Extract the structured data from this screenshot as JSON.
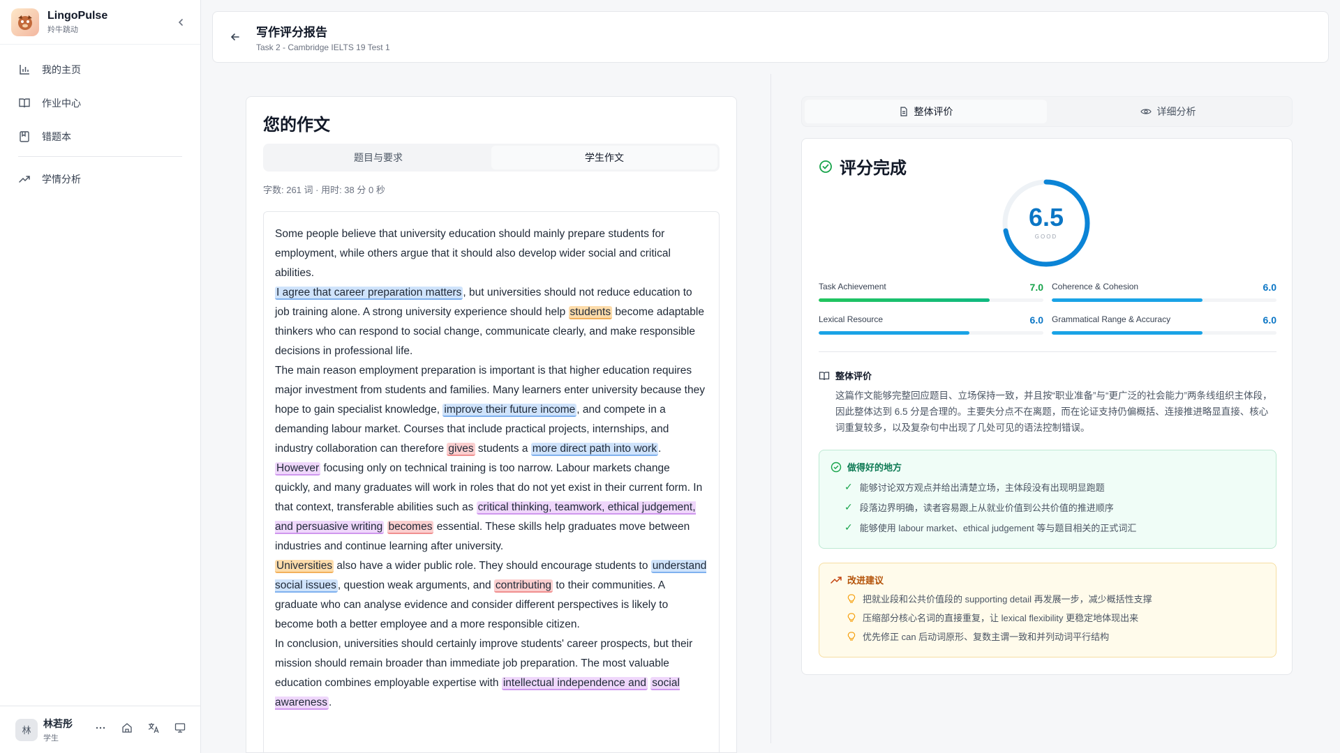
{
  "brand": {
    "name": "LingoPulse",
    "sub": "羚牛跳动"
  },
  "nav": [
    {
      "label": "我的主页",
      "icon": "bar-chart-icon"
    },
    {
      "label": "作业中心",
      "icon": "book-open-icon"
    },
    {
      "label": "错题本",
      "icon": "notebook-icon"
    },
    {
      "label": "学情分析",
      "icon": "trending-up-icon"
    }
  ],
  "user": {
    "avatar": "林",
    "name": "林若彤",
    "role": "学生"
  },
  "header": {
    "title": "写作评分报告",
    "subtitle": "Task 2 - Cambridge IELTS 19 Test 1"
  },
  "essay": {
    "title": "您的作文",
    "tabs": [
      "题目与要求",
      "学生作文"
    ],
    "meta": "字数: 261 词 · 用时: 38 分 0 秒",
    "p1": "Some people believe that university education should mainly prepare students for employment, while others argue that it should also develop wider social and critical abilities.",
    "p2": [
      {
        "hl": "blue",
        "t": "I agree that career preparation matters"
      },
      {
        "t": ", but universities should not reduce education to job training alone. A strong university experience should help "
      },
      {
        "hl": "orange",
        "t": "students"
      },
      {
        "t": " become adaptable thinkers who can respond to social change, communicate clearly, and make responsible decisions in professional life."
      }
    ],
    "p3": [
      {
        "t": "The main reason employment preparation is important is that higher education requires major investment from students and families. Many learners enter university because they hope to gain specialist knowledge, "
      },
      {
        "hl": "blue",
        "t": "improve their future income"
      },
      {
        "t": ", and compete in a demanding labour market. Courses that include practical projects, internships, and industry collaboration can therefore "
      },
      {
        "hl": "red",
        "t": "gives"
      },
      {
        "t": " students a "
      },
      {
        "hl": "blue",
        "t": "more direct path into work"
      },
      {
        "t": "."
      }
    ],
    "p4": [
      {
        "hl": "purple",
        "t": "However"
      },
      {
        "t": " focusing only on technical training is too narrow. Labour markets change quickly, and many graduates will work in roles that do not yet exist in their current form. In that context, transferable abilities such as "
      },
      {
        "hl": "purple",
        "t": "critical thinking, teamwork, ethical judgement, and persuasive writing"
      },
      {
        "t": " "
      },
      {
        "hl": "red",
        "t": "becomes"
      },
      {
        "t": " essential. These skills help graduates move between industries and continue learning after university."
      }
    ],
    "p5": [
      {
        "hl": "orange",
        "t": "Universities"
      },
      {
        "t": " also have a wider public role. They should encourage students to "
      },
      {
        "hl": "blue",
        "t": "understand social issues"
      },
      {
        "t": ", question weak arguments, and "
      },
      {
        "hl": "red",
        "t": "contributing"
      },
      {
        "t": " to their communities. A graduate who can analyse evidence and consider different perspectives is likely to become both a better employee and a more responsible citizen."
      }
    ],
    "p6": [
      {
        "t": "In conclusion, universities should certainly improve students' career prospects, but their mission should remain broader than immediate job preparation. The most valuable education combines employable expertise with "
      },
      {
        "hl": "purple",
        "t": "intellectual independence and"
      },
      {
        "t": " "
      },
      {
        "hl": "purple",
        "t": "social awareness"
      },
      {
        "t": "."
      }
    ]
  },
  "right": {
    "tabs": [
      "整体评价",
      "详细分析"
    ],
    "title": "评分完成",
    "score": "6.5",
    "score_label": "GOOD",
    "score_fraction": 0.72,
    "criteria": [
      {
        "name": "Task Achievement",
        "value": "7.0",
        "fraction": 0.76
      },
      {
        "name": "Coherence & Cohesion",
        "value": "6.0",
        "fraction": 0.67
      },
      {
        "name": "Lexical Resource",
        "value": "6.0",
        "fraction": 0.67
      },
      {
        "name": "Grammatical Range & Accuracy",
        "value": "6.0",
        "fraction": 0.67
      }
    ],
    "overall_title": "整体评价",
    "overall_text": "这篇作文能够完整回应题目、立场保持一致，并且按“职业准备”与“更广泛的社会能力”两条线组织主体段，因此整体达到 6.5 分是合理的。主要失分点不在离题，而在论证支持仍偏概括、连接推进略显直接、核心词重复较多，以及复杂句中出现了几处可见的语法控制错误。",
    "good_title": "做得好的地方",
    "good": [
      "能够讨论双方观点并给出清楚立场，主体段没有出现明显跑题",
      "段落边界明确，读者容易跟上从就业价值到公共价值的推进顺序",
      "能够使用 labour market、ethical judgement 等与题目相关的正式词汇"
    ],
    "improve_title": "改进建议",
    "improve": [
      "把就业段和公共价值段的 supporting detail 再发展一步，减少概括性支撑",
      "压缩部分核心名词的直接重复，让 lexical flexibility 更稳定地体现出来",
      "优先修正 can 后动词原形、复数主谓一致和并列动词平行结构"
    ]
  }
}
